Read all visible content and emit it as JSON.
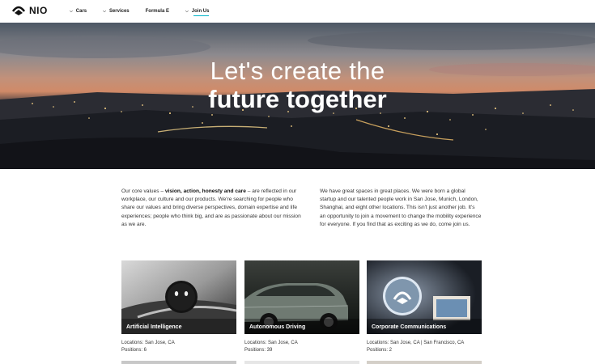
{
  "brand": {
    "name": "NIO"
  },
  "nav": {
    "items": [
      {
        "label": "Cars",
        "has_dropdown": true
      },
      {
        "label": "Services",
        "has_dropdown": true
      },
      {
        "label": "Formula E",
        "has_dropdown": false
      },
      {
        "label": "Join Us",
        "has_dropdown": true,
        "active": true
      }
    ],
    "accent": "#00b4c8"
  },
  "hero": {
    "line1": "Let's create the",
    "line2": "future together"
  },
  "intro": {
    "left_prefix": "Our core values – ",
    "left_bold": "vision, action, honesty and care",
    "left_suffix": " – are reflected in our workplace, our culture and our products. We're searching for people who share our values and bring diverse perspectives, domain expertise and life experiences; people who think big, and are as passionate about our mission as we are.",
    "right": "We have great spaces in great places. We were born a global startup and our talented people work in San Jose, Munich, London, Shanghai, and eight other locations. This isn't just another job. It's an opportunity to join a movement to change the mobility experience for everyone. If you find that as exciting as we do, come join us."
  },
  "cards": [
    {
      "title": "Artificial Intelligence",
      "locations": "Locations: San Jose, CA",
      "positions": "Positions: 6"
    },
    {
      "title": "Autonomous Driving",
      "locations": "Locations: San Jose, CA",
      "positions": "Positions: 39"
    },
    {
      "title": "Corporate Communications",
      "locations": "Locations: San Jose, CA | San Francisco, CA",
      "positions": "Positions: 2"
    }
  ]
}
